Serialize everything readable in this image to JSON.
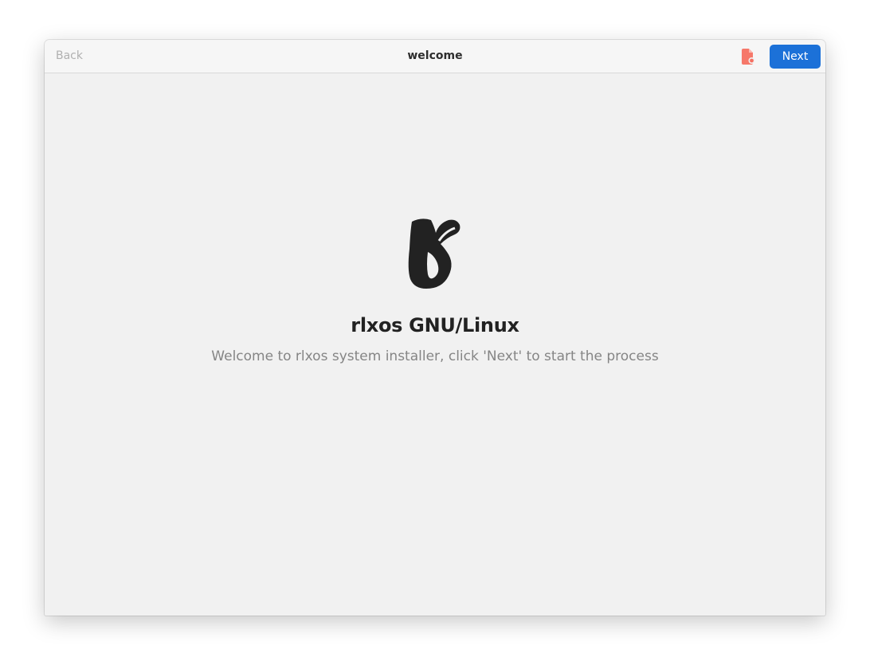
{
  "header": {
    "back_label": "Back",
    "title": "welcome",
    "next_label": "Next",
    "report_icon": "document-bug-icon",
    "report_icon_color": "#f66151",
    "next_color": "#1c71d8"
  },
  "main": {
    "logo_icon": "rlxos-logo",
    "title": "rlxos GNU/Linux",
    "subtitle": "Welcome to rlxos system installer, click 'Next' to start the process"
  }
}
